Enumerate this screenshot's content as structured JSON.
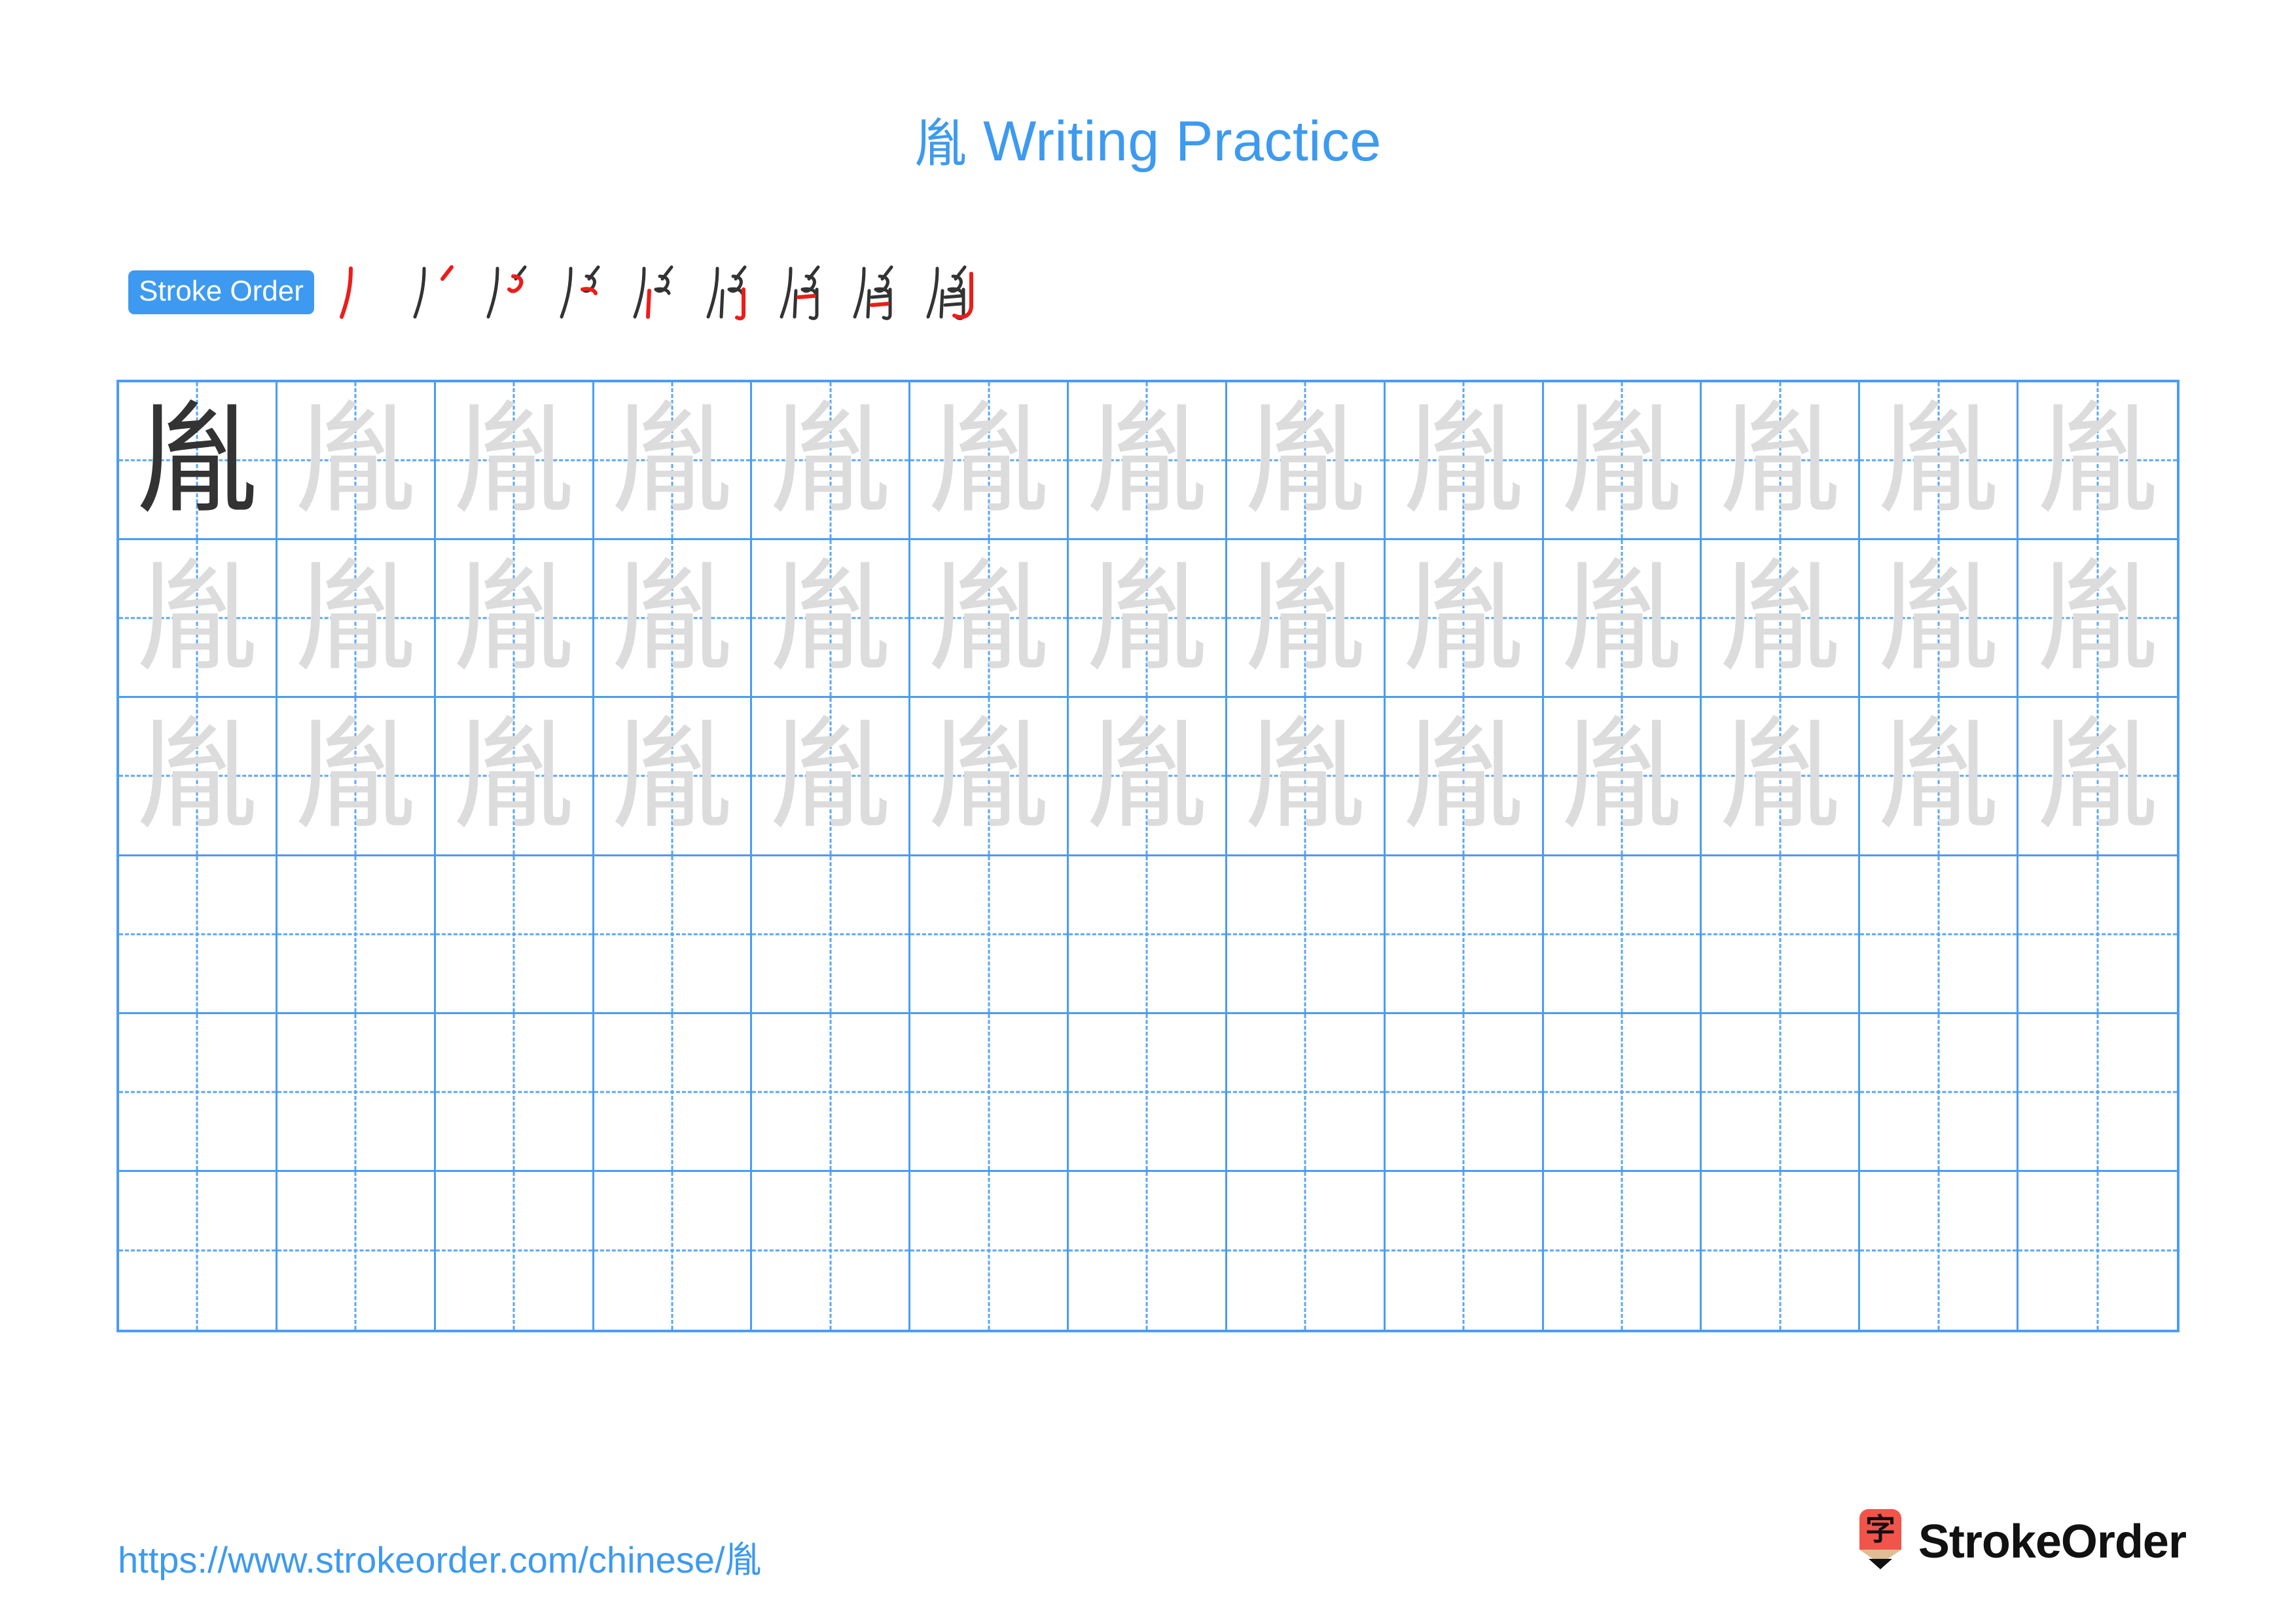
{
  "character": "胤",
  "title": {
    "character": "胤",
    "suffix": " Writing Practice",
    "full": "胤 Writing Practice",
    "color": "#3d9af0"
  },
  "stroke_order": {
    "badge_label": "Stroke Order",
    "badge_bg": "#3d9af0",
    "badge_text_color": "#ffffff",
    "existing_stroke_color": "#333333",
    "new_stroke_color": "#ee1c19",
    "total_strokes": 9,
    "steps": [
      {
        "step": 1,
        "strokes_shown": 1,
        "new_stroke": "丿"
      },
      {
        "step": 2,
        "strokes_shown": 2,
        "new_stroke": "丶"
      },
      {
        "step": 3,
        "strokes_shown": 3,
        "new_stroke": "㇀"
      },
      {
        "step": 4,
        "strokes_shown": 4,
        "new_stroke": "乚"
      },
      {
        "step": 5,
        "strokes_shown": 5,
        "new_stroke": "丨"
      },
      {
        "step": 6,
        "strokes_shown": 6,
        "new_stroke": "𠃌"
      },
      {
        "step": 7,
        "strokes_shown": 7,
        "new_stroke": "一"
      },
      {
        "step": 8,
        "strokes_shown": 8,
        "new_stroke": "一"
      },
      {
        "step": 9,
        "strokes_shown": 9,
        "new_stroke": "乚"
      }
    ]
  },
  "practice_grid": {
    "columns": 13,
    "rows": 6,
    "line_color": "#4a9cf5",
    "guide_color": "#5aa6f7",
    "dark_char_color": "#333333",
    "trace_char_color": "#dcdcdc",
    "cells": [
      [
        "dark",
        "trace",
        "trace",
        "trace",
        "trace",
        "trace",
        "trace",
        "trace",
        "trace",
        "trace",
        "trace",
        "trace",
        "trace"
      ],
      [
        "trace",
        "trace",
        "trace",
        "trace",
        "trace",
        "trace",
        "trace",
        "trace",
        "trace",
        "trace",
        "trace",
        "trace",
        "trace"
      ],
      [
        "trace",
        "trace",
        "trace",
        "trace",
        "trace",
        "trace",
        "trace",
        "trace",
        "trace",
        "trace",
        "trace",
        "trace",
        "trace"
      ],
      [
        "empty",
        "empty",
        "empty",
        "empty",
        "empty",
        "empty",
        "empty",
        "empty",
        "empty",
        "empty",
        "empty",
        "empty",
        "empty"
      ],
      [
        "empty",
        "empty",
        "empty",
        "empty",
        "empty",
        "empty",
        "empty",
        "empty",
        "empty",
        "empty",
        "empty",
        "empty",
        "empty"
      ],
      [
        "empty",
        "empty",
        "empty",
        "empty",
        "empty",
        "empty",
        "empty",
        "empty",
        "empty",
        "empty",
        "empty",
        "empty",
        "empty"
      ]
    ]
  },
  "footer": {
    "url_prefix": "https://www.strokeorder.com/chinese/",
    "url_character": "胤",
    "url_full": "https://www.strokeorder.com/chinese/胤",
    "url_color": "#3d9af0",
    "brand_name": "StrokeOrder",
    "logo_glyph": "字",
    "logo_body_color": "#f1544b",
    "logo_wood_color": "#e0bc94",
    "logo_tip_color": "#111111"
  }
}
